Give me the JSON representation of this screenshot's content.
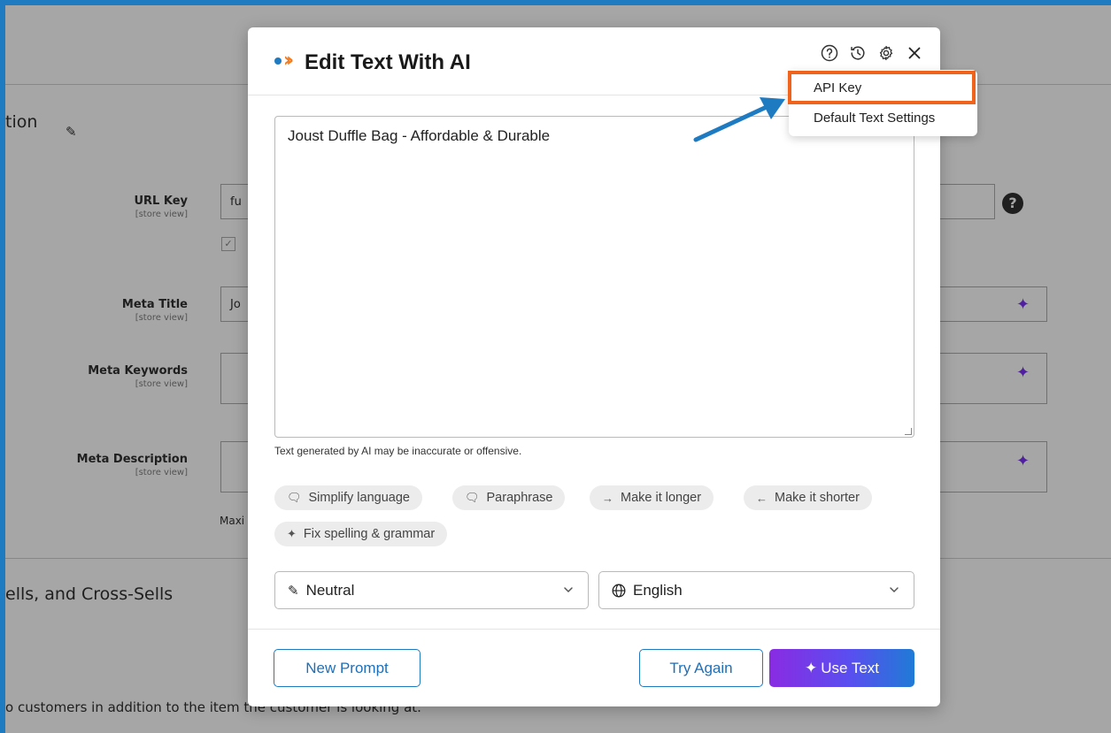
{
  "background": {
    "section_title_1": "tion",
    "section_title_2": "ells, and Cross-Sells",
    "fields": [
      {
        "label": "URL Key",
        "scope": "[store view]",
        "value": "fu"
      },
      {
        "label": "Meta Title",
        "scope": "[store view]",
        "value": "Jo"
      },
      {
        "label": "Meta Keywords",
        "scope": "[store view]",
        "value": ""
      },
      {
        "label": "Meta Description",
        "scope": "[store view]",
        "value": ""
      }
    ],
    "help_icon_text": "?",
    "maxi_text": "Maxi",
    "bottom_text": "o customers in addition to the item the customer is looking at."
  },
  "modal": {
    "title": "Edit Text With AI",
    "header_icons": [
      "help-icon",
      "history-icon",
      "settings-icon",
      "close-icon"
    ],
    "textarea_value": "Joust Duffle Bag - Affordable & Durable",
    "disclaimer": "Text generated by AI may be inaccurate or offensive.",
    "chips": [
      {
        "icon": "🗨",
        "label": "Simplify language"
      },
      {
        "icon": "🗨",
        "label": "Paraphrase"
      },
      {
        "icon": "→",
        "label": "Make it longer"
      },
      {
        "icon": "←",
        "label": "Make it shorter"
      },
      {
        "icon": "✦",
        "label": "Fix spelling & grammar"
      }
    ],
    "tone_select": "Neutral",
    "language_select": "English",
    "buttons": {
      "new_prompt": "New Prompt",
      "try_again": "Try Again",
      "use_text": "Use Text"
    }
  },
  "settings_menu": {
    "items": [
      "API Key",
      "Default Text Settings"
    ]
  },
  "colors": {
    "accent": "#1f7bc1",
    "highlight": "#f0631c",
    "brand_orange": "#f47c20",
    "ai_purple": "#8a2be2"
  }
}
